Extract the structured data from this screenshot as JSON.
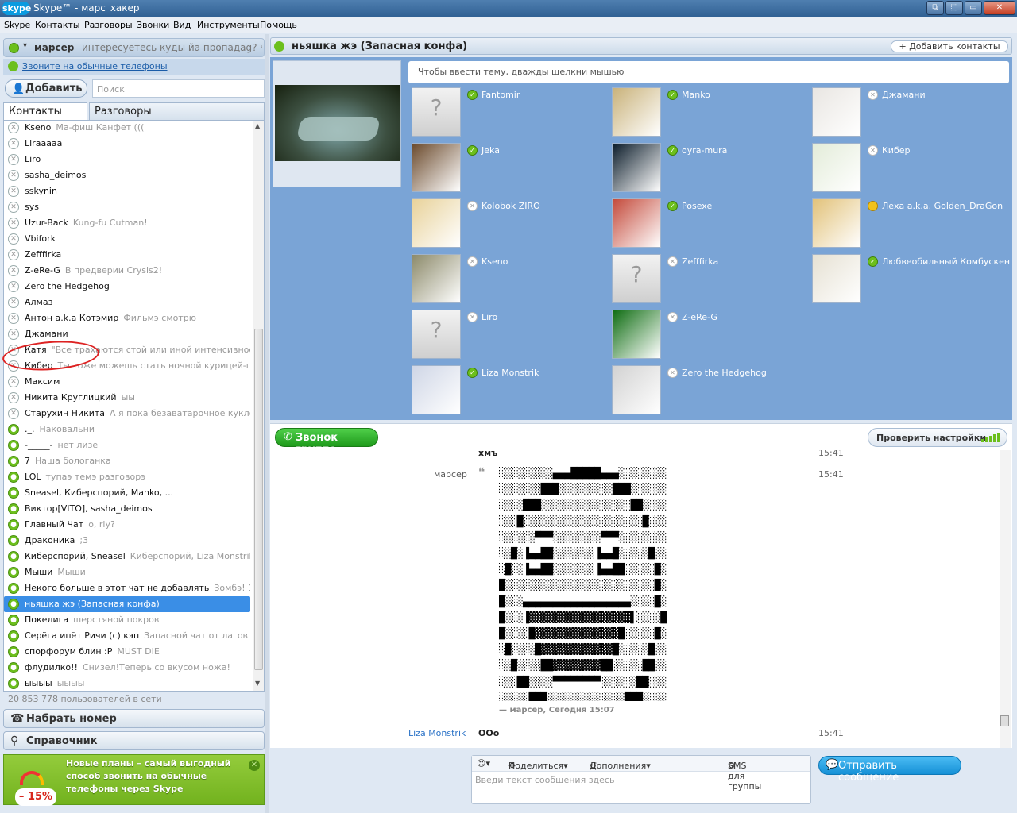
{
  "window": {
    "logo": "skype",
    "title": "Skype™ - марс_хакер",
    "buttons": [
      "⧉",
      "⬚",
      "▭",
      "✕"
    ]
  },
  "menu": [
    "Skype",
    "Контакты",
    "Разговоры",
    "Звонки",
    "Вид",
    "Инструменты",
    "Помощь"
  ],
  "profile": {
    "name": "марсер",
    "mood": "интересуетесь куды йа пропадаg? ч...",
    "phone_link": "Звоните на обычные телефоны"
  },
  "add_button": "Добавить",
  "search_placeholder": "Поиск",
  "tabs": [
    "Контакты",
    "Разговоры"
  ],
  "contacts": [
    {
      "name": "Kseno",
      "mood": "Ма-фиш Канфет (((",
      "group": false
    },
    {
      "name": "Liraaaaa",
      "mood": "",
      "group": false
    },
    {
      "name": "Liro",
      "mood": "",
      "group": false
    },
    {
      "name": "sasha_deimos",
      "mood": "",
      "group": false
    },
    {
      "name": "sskynin",
      "mood": "",
      "group": false
    },
    {
      "name": "sys",
      "mood": "",
      "group": false
    },
    {
      "name": "Uzur-Back",
      "mood": "Kung-fu Cutman!",
      "group": false
    },
    {
      "name": "Vbifork",
      "mood": "",
      "group": false
    },
    {
      "name": "Zefffirka",
      "mood": "",
      "group": false
    },
    {
      "name": "Z-eRe-G",
      "mood": "В предверии Crysis2!",
      "group": false
    },
    {
      "name": "Zero the Hedgehog",
      "mood": "",
      "group": false
    },
    {
      "name": "Алмаз",
      "mood": "",
      "group": false
    },
    {
      "name": "Антон a.k.a Котэмир",
      "mood": "Фильмэ смотрю",
      "group": false
    },
    {
      "name": "Джамани",
      "mood": "",
      "group": false
    },
    {
      "name": "Катя",
      "mood": "\"Все трахаются стой или иной интенсивность...",
      "group": false
    },
    {
      "name": "Кибер",
      "mood": "Ты тоже можешь стать ночной курицей-гриль!",
      "group": false
    },
    {
      "name": "Максим",
      "mood": "",
      "group": false
    },
    {
      "name": "Никита Круглицкий",
      "mood": "ыы",
      "group": false
    },
    {
      "name": "Старухин Никита",
      "mood": "А я пока безаватарочное кукло!",
      "group": false
    },
    {
      "name": "._.",
      "mood": "Наковальни",
      "group": true
    },
    {
      "name": "-_____-",
      "mood": "нет лизе",
      "group": true
    },
    {
      "name": "7",
      "mood": "Наша бологанка",
      "group": true
    },
    {
      "name": "LOL",
      "mood": "тупаэ темэ разговорэ",
      "group": true
    },
    {
      "name": "Sneasel, Киберспорий, Manko, ...",
      "mood": "",
      "group": true
    },
    {
      "name": "Виктор[VITO], sasha_deimos",
      "mood": "",
      "group": true
    },
    {
      "name": "Главный Чат",
      "mood": "o, rly?",
      "group": true
    },
    {
      "name": "Драконика",
      "mood": ";3",
      "group": true
    },
    {
      "name": "Киберспорий, Sneasel",
      "mood": "Киберспорий, Liza Monstrik, Ев...",
      "group": true
    },
    {
      "name": "Мыши",
      "mood": "Мыши",
      "group": true
    },
    {
      "name": "Некого больше в этот чат не добавлять",
      "mood": "Зомбэ! 1",
      "group": true
    },
    {
      "name": "ньяшка жэ (Запасная конфа)",
      "mood": "",
      "group": true,
      "selected": true
    },
    {
      "name": "Покелига",
      "mood": "шерстяной покров",
      "group": true
    },
    {
      "name": "Серёга ипёт Ричи (с) кэп",
      "mood": "Запасной чат от лагов",
      "group": true
    },
    {
      "name": "спорфорум блин :P",
      "mood": "MUST DIE",
      "group": true
    },
    {
      "name": "флудилко!!",
      "mood": "Снизел!Теперь со вкусом ножа!",
      "group": true
    },
    {
      "name": "ыыыы",
      "mood": "ыыыы",
      "group": true
    }
  ],
  "online_count": "20 853 778 пользователей в сети",
  "dial_button": "Набрать номер",
  "directory_button": "Справочник",
  "promo": {
    "badge": "– 15%",
    "text": "Новые планы – самый выгодный способ звонить на обычные телефоны через Skype"
  },
  "conversation": {
    "title": "ньяшка жэ (Запасная конфа)",
    "add_contacts": "Добавить контакты",
    "topic_placeholder": "Чтобы ввести тему, дважды щелкни мышью",
    "members": [
      {
        "name": "Fantomir",
        "status": "online",
        "avatar": "default"
      },
      {
        "name": "Manko",
        "status": "online",
        "avatar": "#c9b27a"
      },
      {
        "name": "Джамани",
        "status": "offline",
        "avatar": "#e9e6e2"
      },
      {
        "name": "Jeka",
        "status": "online",
        "avatar": "#6b4a2c"
      },
      {
        "name": "oyra-mura",
        "status": "online",
        "avatar": "#0b1c2a"
      },
      {
        "name": "Кибер",
        "status": "offline",
        "avatar": "#e3ecd9"
      },
      {
        "name": "Kolobok ZIRO",
        "status": "offline",
        "avatar": "#e8d29a"
      },
      {
        "name": "Posexe",
        "status": "online",
        "avatar": "#c44a3b"
      },
      {
        "name": "Леха a.k.a. Golden_DraGon",
        "status": "away",
        "avatar": "#e2c27a"
      },
      {
        "name": "Kseno",
        "status": "offline",
        "avatar": "#8c8a6a"
      },
      {
        "name": "Zefffirka",
        "status": "offline",
        "avatar": "default"
      },
      {
        "name": "Любвеобильный Комбускен",
        "status": "online",
        "avatar": "#e6e1d3"
      },
      {
        "name": "Liro",
        "status": "offline",
        "avatar": "default"
      },
      {
        "name": "Z-eRe-G",
        "status": "offline",
        "avatar": "#0f6d12"
      },
      {
        "name": "",
        "status": "",
        "avatar": ""
      },
      {
        "name": "Liza Monstrik",
        "status": "online",
        "avatar": "#cfd6e6"
      },
      {
        "name": "Zero the Hedgehog",
        "status": "offline",
        "avatar": "#d2d2d2"
      }
    ]
  },
  "call_group": "Звонок группе",
  "check_settings": "Проверить настройки",
  "messages": [
    {
      "author": "",
      "text": "хмъ",
      "time": "15:41"
    },
    {
      "author": "марсер",
      "time": "15:41"
    },
    {
      "author": "Liza Monstrik",
      "text": "OOo",
      "time": "15:41"
    }
  ],
  "ascii_art": "░░░░░░░░░▄▄▄█████▄▄▄░░░░░░░░\n░░░░░░░███░░░░░░░░░███░░░░░░\n░░░░███░░░░░░░░░░░░░░░██░░░░\n░░░█░░░░░░░░░░░░░░░░░░░░█░░░\n░░░░░░▀▀▀░░░░░░░░▀▀▀░░░░░░░░\n░░█░▐▄▄██░░░░░░░▐▄▄█░░░░░█░░\n░█░░▐▄▄██░░░░░░░▐▄▄██░░░░░█░\n█░░░░░░░░░░░░░░░░░░░░░░░░░█░\n█░░░▄▄▄▄▄▄▄▄▄▄▄▄▄▄▄▄▄▄░░░░█░\n█░░░▐▓▓▓▓▓▓▓▓▓▓▓▓▓▓▓▓▓▌░░░░█\n█░░░░█▓▓▓▓▓▓▓▓▓▓▓▓▓▓█░░░░░█░\n░█░░░░█▓▓▓▓▓▓▓▓▓▓▓▓█░░░░░█░░\n░░█░░░░██▓▓▓▓▓▓▓▓██░░░░░██░░\n░░░██░░░░▀▀▀▀▀▀▀▀░░░░░░██░░░\n░░░░░███░░░░░░░░░░░░░███░░░░\n░░░░░░░░█████████████░░░░░░░",
  "signature": "— марсер, Сегодня 15:07",
  "compose": {
    "emoji": "☺▾",
    "share": "Поделиться▾",
    "extras": "Дополнения▾",
    "sms": "SMS для группы",
    "placeholder": "Введи текст сообщения здесь"
  },
  "send_button": "Отправить сообщение"
}
